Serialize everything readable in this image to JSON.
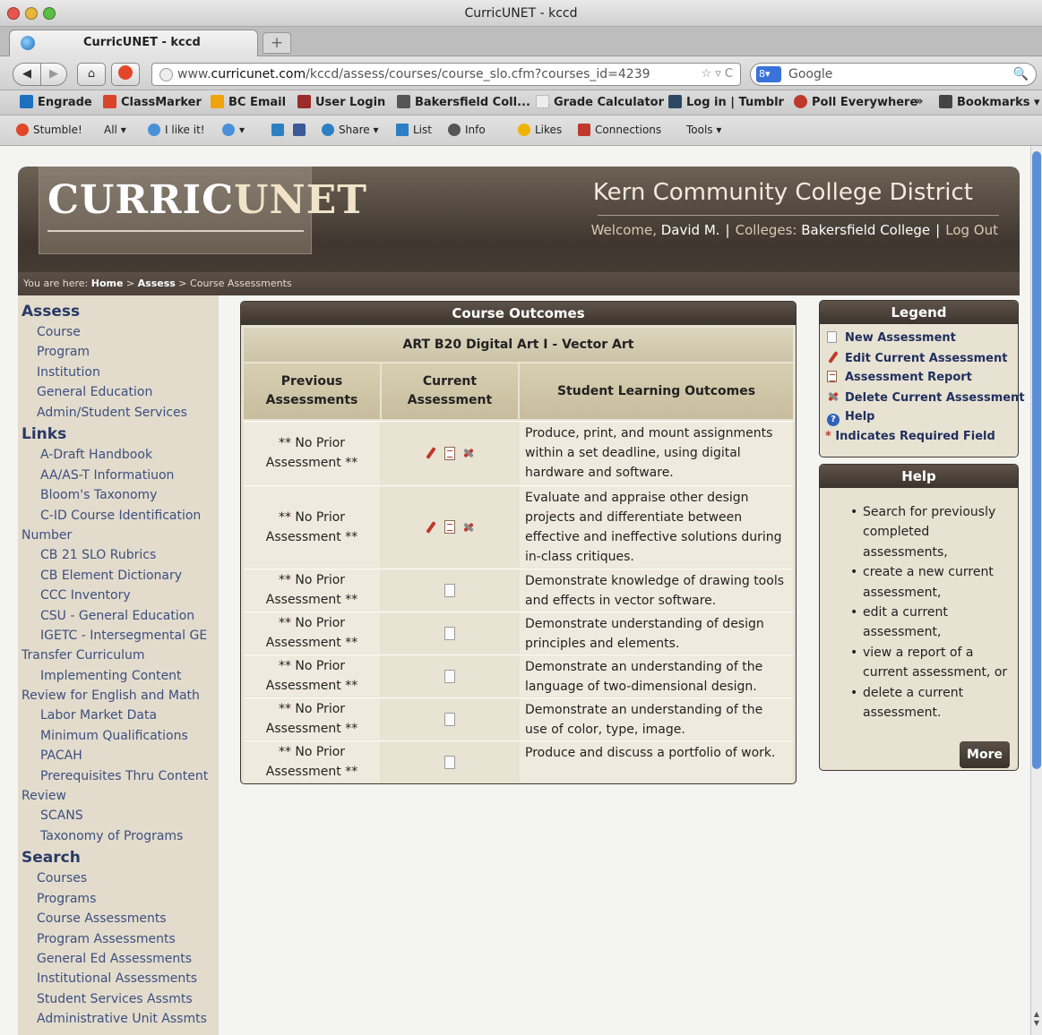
{
  "window": {
    "title": "CurricUNET - kccd"
  },
  "tab": {
    "label": "CurricUNET - kccd",
    "close": "",
    "new_tab": "+"
  },
  "nav": {
    "back": "◀",
    "forward": "▶",
    "home": "⌂",
    "url_prefix": "www.",
    "url_domain": "curricunet.com",
    "url_path": "/kccd/assess/courses/course_slo.cfm?courses_id=4239",
    "url_icons": "☆ ▿ C",
    "search_engine": "8▾",
    "search_placeholder": "Google",
    "search_icon": "🔍"
  },
  "bookmarks": [
    {
      "label": "Engrade",
      "color": "#1d6fc2"
    },
    {
      "label": "ClassMarker",
      "color": "#d9452b"
    },
    {
      "label": "BC Email",
      "color": "#f0a30a"
    },
    {
      "label": "User Login",
      "color": "#9b2a2a"
    },
    {
      "label": "Bakersfield Coll...",
      "color": "#555555"
    },
    {
      "label": "Grade Calculator",
      "color": "#cccccc"
    },
    {
      "label": "Log in | Tumblr",
      "color": "#2c4762"
    },
    {
      "label": "Poll Everywhere",
      "color": "#c0392b"
    },
    {
      "label": "»",
      "color": ""
    },
    {
      "label": "Bookmarks ▾",
      "color": "#444444"
    }
  ],
  "stumble": [
    {
      "label": "Stumble!",
      "color": "#e2462a"
    },
    {
      "label": "All  ▾",
      "color": ""
    },
    {
      "label": "I like it!",
      "color": "#4a90d9"
    },
    {
      "label": "▾",
      "color": "#4a90d9"
    },
    {
      "label": "Share  ▾",
      "color": "#2d7fc4"
    },
    {
      "label": "List",
      "color": "#2d7fc4"
    },
    {
      "label": "Info",
      "color": "#555555"
    },
    {
      "label": "Likes",
      "color": "#f0b400"
    },
    {
      "label": "Connections",
      "color": "#c0392b"
    },
    {
      "label": "Tools  ▾",
      "color": ""
    }
  ],
  "site": {
    "logo_part1": "CURRIC",
    "logo_part2": "UNET",
    "district": "Kern Community College District",
    "welcome_label": "Welcome, ",
    "welcome_name": "David M.",
    "colleges_label": "Colleges: ",
    "college_name": "Bakersfield College",
    "sep": "|",
    "logout": "Log Out"
  },
  "breadcrumb": {
    "prefix": "You are here: ",
    "home": "Home",
    "arrow": " > ",
    "assess": "Assess",
    "current": "Course Assessments"
  },
  "sidebar": {
    "assess_heading": "Assess",
    "assess_items": [
      "Course",
      "Program",
      "Institution",
      "General Education",
      "Admin/Student Services"
    ],
    "links_heading": "Links",
    "links_items": [
      "A-Draft Handbook",
      "AA/AS-T Informatiuon",
      "Bloom's Taxonomy",
      "C-ID Course Identification",
      "Number",
      "CB 21 SLO Rubrics",
      "CB Element Dictionary",
      "CCC Inventory",
      "CSU - General Education",
      "IGETC - Intersegmental GE",
      "Transfer Curriculum",
      "Implementing Content",
      "Review for English and Math",
      "Labor Market Data",
      "Minimum Qualifications",
      "PACAH",
      "Prerequisites Thru Content",
      "Review",
      "SCANS",
      "Taxonomy of Programs"
    ],
    "search_heading": "Search",
    "search_items": [
      "Courses",
      "Programs",
      "Course Assessments",
      "Program Assessments",
      "General Ed Assessments",
      "Institutional Assessments",
      "Student Services Assmts",
      "Administrative Unit Assmts"
    ]
  },
  "outcomes": {
    "title": "Course Outcomes",
    "course": "ART B20 Digital Art I - Vector Art",
    "col_prev_1": "Previous",
    "col_prev_2": "Assessments",
    "col_curr_1": "Current",
    "col_curr_2": "Assessment",
    "col_slo": "Student Learning Outcomes",
    "no_prior_1": "** No Prior",
    "no_prior_2": "Assessment **",
    "rows": [
      {
        "slo": "Produce, print, and mount assignments within a set deadline, using digital hardware and software.",
        "actions": "edit"
      },
      {
        "slo": "Evaluate and appraise other design projects and differentiate between effective and ineffective solutions during in-class critiques.",
        "actions": "edit"
      },
      {
        "slo": "Demonstrate knowledge of drawing tools and effects in vector software.",
        "actions": "new"
      },
      {
        "slo": "Demonstrate understanding of design principles and elements.",
        "actions": "new"
      },
      {
        "slo": "Demonstrate an understanding of the language of two-dimensional design.",
        "actions": "new"
      },
      {
        "slo": "Demonstrate an understanding of the use of color, type, image.",
        "actions": "new"
      },
      {
        "slo": "Produce and discuss a portfolio of work.",
        "actions": "new"
      }
    ]
  },
  "legend": {
    "title": "Legend",
    "new": "New Assessment",
    "edit": "Edit Current Assessment",
    "report": "Assessment Report",
    "delete": "Delete Current Assessment",
    "help": "Help",
    "required_mark": "*",
    "required": "Indicates Required Field"
  },
  "help": {
    "title": "Help",
    "items": [
      "Search for previously completed assessments,",
      "create a new current assessment,",
      "edit a current assessment,",
      "view a report of a current assessment, or",
      "delete a current assessment."
    ],
    "more": "More"
  },
  "colors": {
    "brown_dark": "#3e362f",
    "link_blue": "#3c4f7e",
    "required_red": "#c0392b"
  }
}
